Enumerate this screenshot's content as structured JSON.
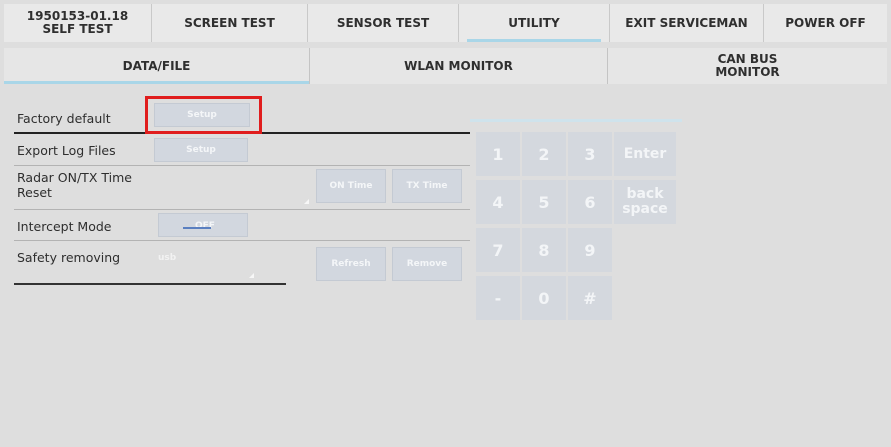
{
  "top_tabs": [
    {
      "line1": "1950153-01.18",
      "line2": "SELF TEST"
    },
    {
      "label": "SCREEN TEST"
    },
    {
      "label": "SENSOR TEST"
    },
    {
      "label": "UTILITY",
      "active": true
    },
    {
      "label": "EXIT SERVICEMAN"
    },
    {
      "label": "POWER OFF"
    }
  ],
  "sub_tabs": [
    {
      "label": "DATA/FILE",
      "active": true
    },
    {
      "label": "WLAN MONITOR"
    },
    {
      "line1": "CAN BUS",
      "line2": "MONITOR"
    }
  ],
  "settings": {
    "factory_default": {
      "label": "Factory default",
      "button": "Setup"
    },
    "export_log": {
      "label": "Export Log Files",
      "button": "Setup"
    },
    "radar_time": {
      "line1": "Radar ON/TX Time",
      "line2": "Reset",
      "on_time": "ON Time",
      "tx_time": "TX Time"
    },
    "intercept": {
      "label": "Intercept Mode",
      "value": "OFF"
    },
    "safety_removing": {
      "label": "Safety removing",
      "value": "usb",
      "refresh": "Refresh",
      "remove": "Remove"
    }
  },
  "keypad": {
    "keys": [
      "1",
      "2",
      "3",
      "4",
      "5",
      "6",
      "7",
      "8",
      "9",
      "-",
      "0",
      "#"
    ],
    "enter": "Enter",
    "backspace_line1": "back",
    "backspace_line2": "space"
  }
}
